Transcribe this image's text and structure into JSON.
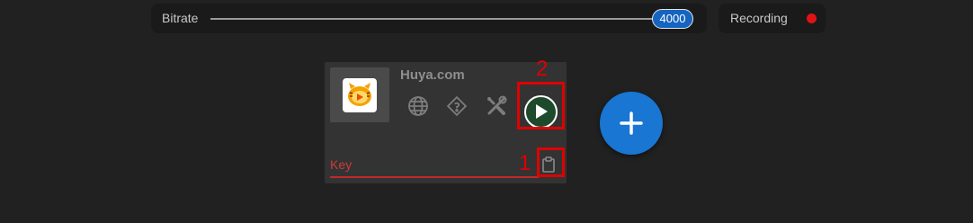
{
  "header": {
    "bitrate": {
      "label": "Bitrate",
      "value": "4000"
    },
    "recording": {
      "label": "Recording",
      "status_color": "#e01313"
    }
  },
  "card": {
    "title": "Huya.com",
    "logo_icon": "huya-tiger-logo",
    "icons": [
      "globe-icon",
      "help-diamond-icon",
      "tools-icon",
      "play-icon"
    ],
    "key_placeholder": "Key",
    "clipboard_icon": "clipboard-icon"
  },
  "annotations": [
    {
      "number": "1",
      "target": "clipboard-paste"
    },
    {
      "number": "2",
      "target": "play-button"
    }
  ],
  "fab": {
    "icon": "plus-icon"
  },
  "colors": {
    "accent": "#1976d2",
    "error": "#c02a2a",
    "highlight": "#e00000",
    "play": "#1e4a2c"
  }
}
